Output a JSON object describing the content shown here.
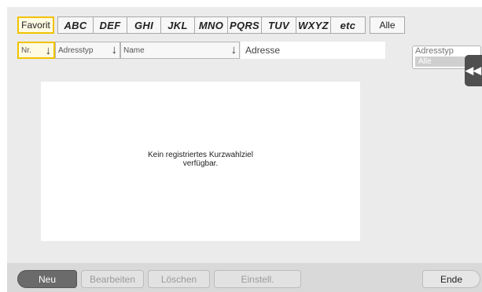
{
  "tabs": [
    {
      "label": "Favorit"
    },
    {
      "label": "ABC"
    },
    {
      "label": "DEF"
    },
    {
      "label": "GHI"
    },
    {
      "label": "JKL"
    },
    {
      "label": "MNO"
    },
    {
      "label": "PQRS"
    },
    {
      "label": "TUV"
    },
    {
      "label": "WXYZ"
    },
    {
      "label": "etc"
    },
    {
      "label": "Alle"
    }
  ],
  "active_tab": "Favorit",
  "sort": {
    "nr": "Nr.",
    "type": "Adresstyp",
    "name": "Name",
    "address": "Adresse"
  },
  "list": {
    "empty_line1": "Kein registriertes Kurzwahlziel",
    "empty_line2": "verfügbar."
  },
  "filter": {
    "label": "Adresstyp",
    "value": "Alle"
  },
  "buttons": {
    "new": "Neu",
    "edit": "Bearbeiten",
    "delete": "Löschen",
    "settings": "Einstell.",
    "end": "Ende"
  },
  "colors": {
    "accent": "#f2c200",
    "panel": "#ebebeb",
    "dark_button": "#6b6b6b"
  },
  "icons": {
    "sort_arrow": "arrow-down-icon",
    "collapse": "double-chevron-left-icon"
  }
}
